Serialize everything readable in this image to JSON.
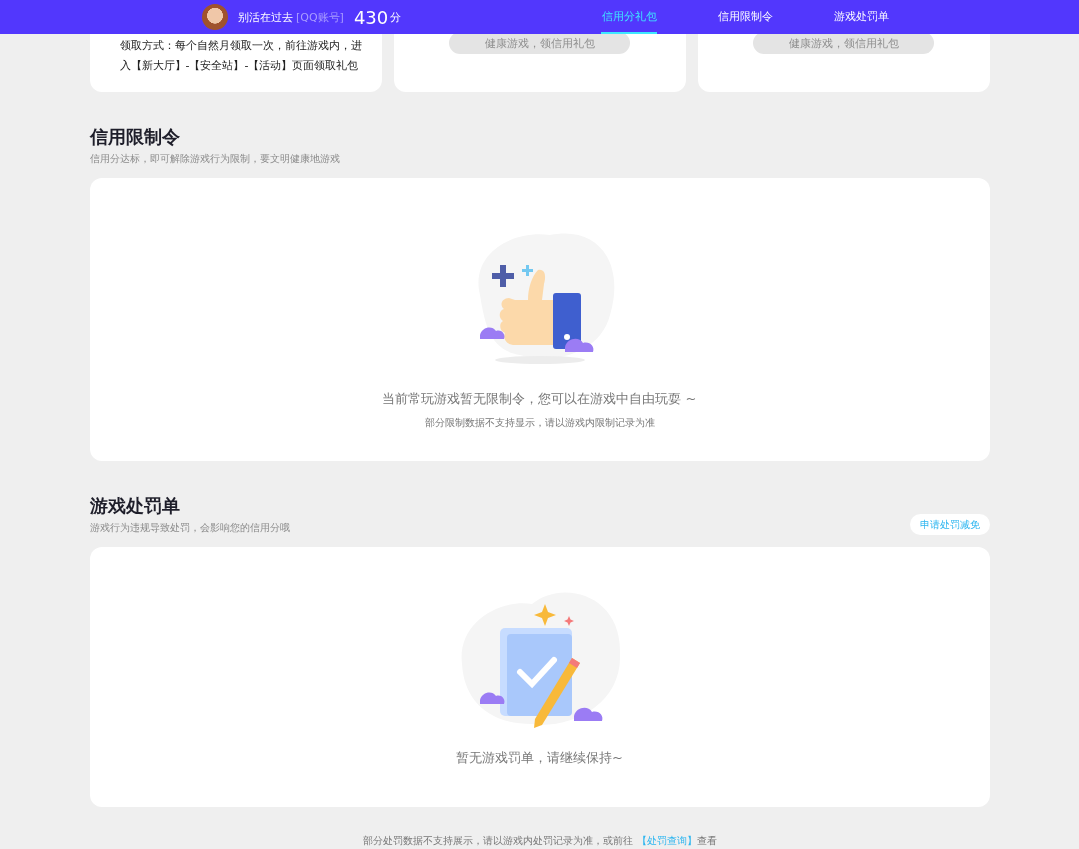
{
  "header": {
    "username": "别活在过去",
    "account_type": "[QQ账号]",
    "score": "430",
    "score_unit": "分",
    "tabs": [
      {
        "label": "信用分礼包",
        "selected": true
      },
      {
        "label": "信用限制令",
        "selected": false
      },
      {
        "label": "游戏处罚单",
        "selected": false
      }
    ]
  },
  "gift_cards": [
    {
      "kind": "text",
      "lines": [
        "领取方式：每个自然月领取一次，前往游戏内，进",
        "入【新大厅】-【安全站】-【活动】页面领取礼包"
      ]
    },
    {
      "kind": "button",
      "button": "健康游戏，领信用礼包",
      "disabled": true
    },
    {
      "kind": "button",
      "button": "健康游戏，领信用礼包",
      "disabled": true
    }
  ],
  "sections": [
    {
      "kind": "thumbs-up",
      "title": "信用限制令",
      "subtitle": "信用分达标，即可解除游戏行为限制，要文明健康地游戏",
      "empty_message": "当前常玩游戏暂无限制令，您可以在游戏中自由玩耍 ~",
      "note": "部分限制数据不支持显示，请以游戏内限制记录为准"
    },
    {
      "kind": "clipboard",
      "title": "游戏处罚单",
      "subtitle": "游戏行为违规导致处罚，会影响您的信用分哦",
      "action": "申请处罚减免",
      "empty_message": "暂无游戏罚单，请继续保持~"
    }
  ],
  "footer": {
    "text": "部分处罚数据不支持展示，请以游戏内处罚记录为准，或前往",
    "link": "【处罚查询】",
    "suffix": "查看"
  }
}
